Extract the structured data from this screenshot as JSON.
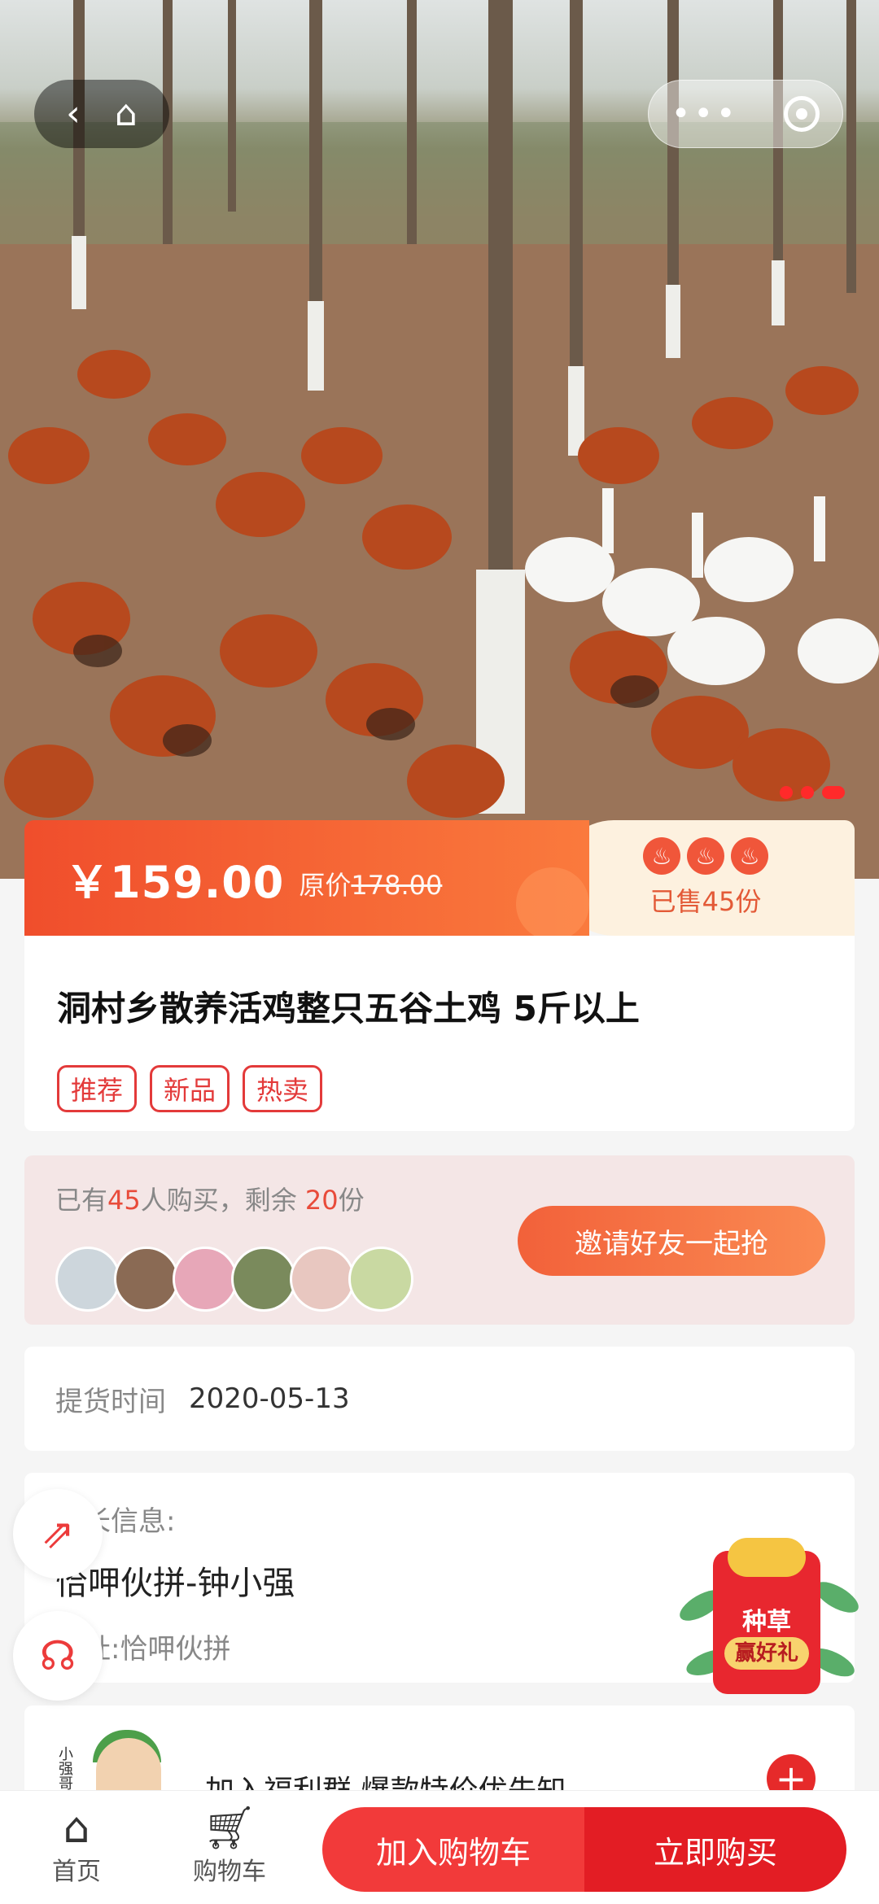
{
  "nav": {
    "back_icon": "‹",
    "home_icon": "⌂",
    "more_icon": "•••"
  },
  "price": {
    "current": "￥159.00",
    "original_label": "原价",
    "original_value": "178.00",
    "sold": "已售45份",
    "flame_icon": "♨"
  },
  "product": {
    "title": "洞村乡散养活鸡整只五谷土鸡 5斤以上",
    "tags": [
      "推荐",
      "新品",
      "热卖"
    ]
  },
  "group_buy": {
    "prefix": "已有",
    "buyers": "45",
    "middle": "人购买，剩余",
    "remaining": "20",
    "suffix": "份",
    "invite_label": "邀请好友一起抢",
    "avatar_colors": [
      "#cdd6dc",
      "#8a6a54",
      "#e7a7b8",
      "#7a8a5c",
      "#e8c7c0",
      "#c9d9a2"
    ]
  },
  "pickup": {
    "label": "提货时间",
    "value": "2020-05-13"
  },
  "leader": {
    "label": "团长信息:",
    "name": "恰呷伙拼-钟小强",
    "address_label": "地址:",
    "address": "恰呷伙拼"
  },
  "join_group": {
    "text": "加入福利群 爆款特价优先知",
    "qr_caption": "小强哥信不信",
    "plus_icon": "+"
  },
  "promo": {
    "line1": "种草",
    "line2": "赢好礼"
  },
  "bottom_bar": {
    "home_label": "首页",
    "cart_label": "购物车",
    "add_cart": "加入购物车",
    "buy_now": "立即购买"
  }
}
